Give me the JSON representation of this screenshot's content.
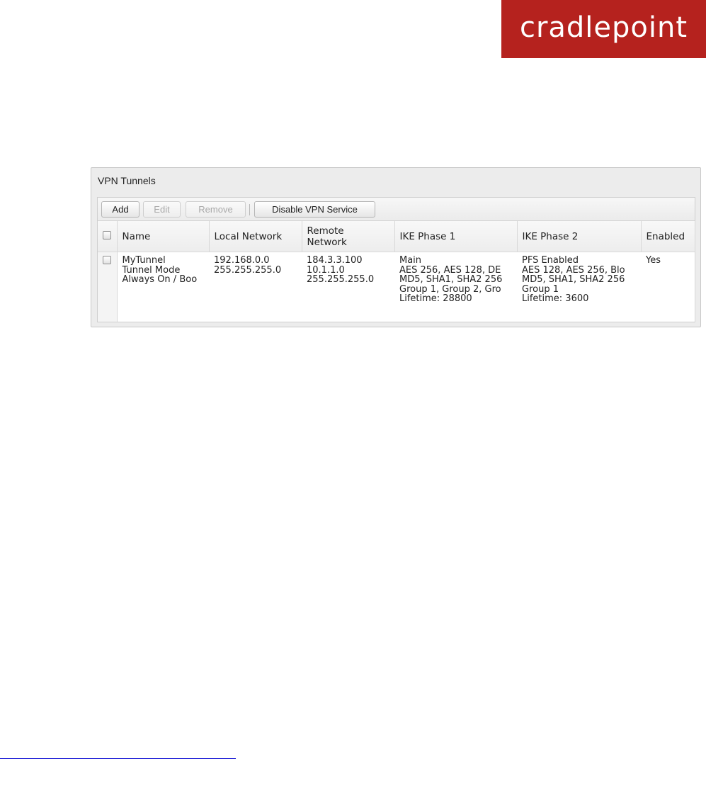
{
  "logo": {
    "text": "cradlepoint"
  },
  "panel": {
    "title": "VPN Tunnels",
    "buttons": {
      "add": "Add",
      "edit": "Edit",
      "remove": "Remove",
      "disable": "Disable VPN Service"
    }
  },
  "table": {
    "headers": {
      "name": "Name",
      "local": "Local Network",
      "remote_1": "Remote",
      "remote_2": "Network",
      "ike1": "IKE Phase 1",
      "ike2": "IKE Phase 2",
      "enabled": "Enabled"
    },
    "rows": [
      {
        "name": [
          "MyTunnel",
          "Tunnel Mode",
          "Always On / Boo"
        ],
        "local": [
          "192.168.0.0",
          "255.255.255.0"
        ],
        "remote": [
          "184.3.3.100",
          "10.1.1.0",
          "255.255.255.0"
        ],
        "ike1": [
          "Main",
          "AES 256, AES 128, DE",
          "MD5, SHA1, SHA2 256",
          "Group 1, Group 2, Gro",
          "Lifetime: 28800"
        ],
        "ike2": [
          "PFS Enabled",
          "AES 128, AES 256, Blo",
          "MD5, SHA1, SHA2 256",
          "Group 1",
          "Lifetime: 3600"
        ],
        "enabled": "Yes"
      }
    ]
  },
  "colors": {
    "brand": "#b5221e",
    "panel_bg": "#ececec",
    "link_line": "#2a2ad8"
  }
}
